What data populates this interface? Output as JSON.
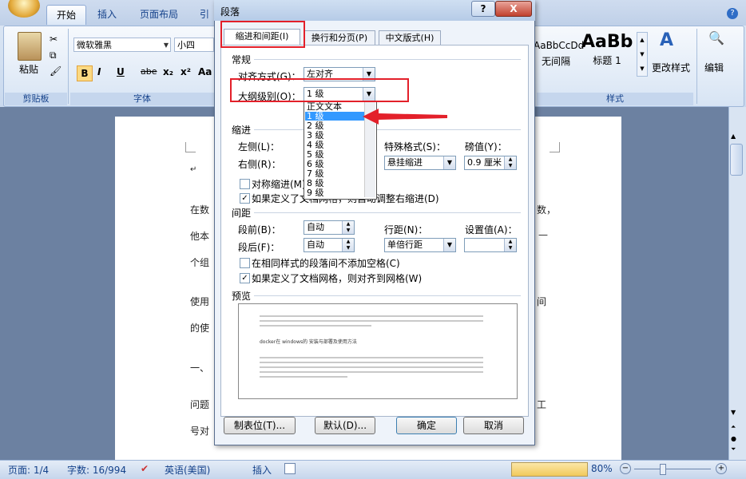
{
  "ribbon": {
    "tabs": [
      "开始",
      "插入",
      "页面布局",
      "引"
    ],
    "font_name": "微软雅黑",
    "font_size": "小四",
    "paste_label": "粘贴",
    "groups": {
      "clipboard": "剪贴板",
      "font": "字体",
      "styles": "样式"
    },
    "format_buttons": [
      "B",
      "I",
      "U",
      "abe",
      "x₂",
      "x²",
      "Aa"
    ],
    "styles": [
      {
        "preview": "AaBbCcDd",
        "label": "无间隔"
      },
      {
        "preview": "AaBb",
        "label": "标题 1"
      }
    ],
    "change_styles": "更改样式",
    "edit": "编辑"
  },
  "document": {
    "lines": [
      "在数",
      "他本",
      "个组",
      "使用",
      "的使",
      "一、",
      "问题",
      "号对"
    ],
    "right_fragments": [
      "数，",
      "—",
      "间",
      "工"
    ]
  },
  "dialog": {
    "title": "段落",
    "help": "?",
    "close": "X",
    "tabs": [
      "缩进和间距(I)",
      "换行和分页(P)",
      "中文版式(H)"
    ],
    "general": {
      "section": "常规",
      "alignment_label": "对齐方式(G)：",
      "alignment_value": "左对齐",
      "outline_label": "大纲级别(O)：",
      "outline_value": "1 级"
    },
    "indent": {
      "section": "缩进",
      "left_label": "左侧(L)：",
      "right_label": "右侧(R)：",
      "special_label": "特殊格式(S)：",
      "special_value": "悬挂缩进",
      "by_label": "磅值(Y)：",
      "by_value": "0.9 厘米",
      "mirror": "对称缩进(M)",
      "auto_adjust": "如果定义了文档网格，则自动调整右缩进(D)"
    },
    "spacing": {
      "section": "间距",
      "before_label": "段前(B)：",
      "before_value": "自动",
      "after_label": "段后(F)：",
      "after_value": "自动",
      "line_label": "行距(N)：",
      "line_value": "单倍行距",
      "at_label": "设置值(A)：",
      "no_space": "在相同样式的段落间不添加空格(C)",
      "snap_grid": "如果定义了文档网格，则对齐到网格(W)"
    },
    "preview": {
      "section": "预览",
      "sample": "docker在 windows的 安装与部署及使用方法"
    },
    "outline_options": [
      "正文文本",
      "1 级",
      "2 级",
      "3 级",
      "4 级",
      "5 级",
      "6 级",
      "7 级",
      "8 级",
      "9 级"
    ],
    "selected_option": "1 级",
    "buttons": {
      "tabs": "制表位(T)...",
      "default": "默认(D)...",
      "ok": "确定",
      "cancel": "取消"
    }
  },
  "status": {
    "page": "页面: 1/4",
    "words": "字数: 16/994",
    "language": "英语(美国)",
    "insert": "插入",
    "zoom": "80%"
  },
  "colors": {
    "highlight": "#e3202a",
    "selection": "#3399ff"
  }
}
